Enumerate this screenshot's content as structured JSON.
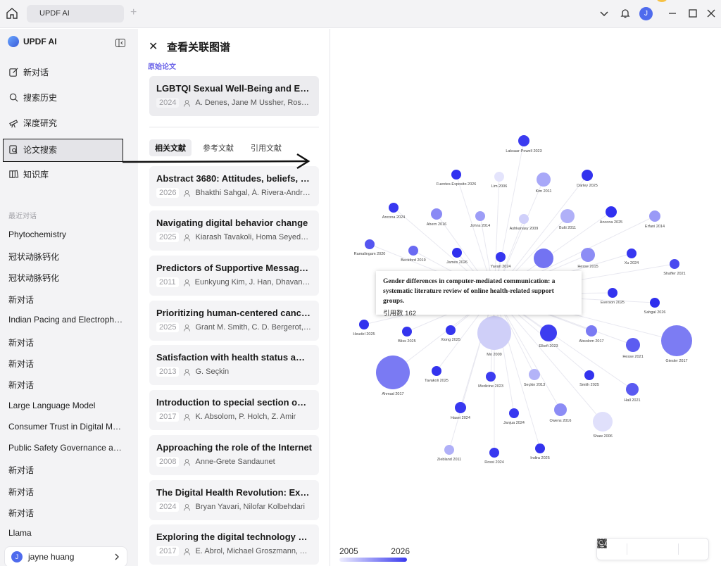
{
  "titlebar": {
    "tab_label": "UPDF AI",
    "avatar_letter": "J"
  },
  "sidebar": {
    "brand": "UPDF AI",
    "nav": [
      {
        "label": "新对话",
        "icon": "edit-icon"
      },
      {
        "label": "搜索历史",
        "icon": "search-icon"
      },
      {
        "label": "深度研究",
        "icon": "telescope-icon"
      },
      {
        "label": "论文搜索",
        "icon": "paper-search-icon"
      },
      {
        "label": "知识库",
        "icon": "book-icon"
      }
    ],
    "recent_label": "最近对话",
    "recent": [
      "Phytochemistry",
      "冠状动脉钙化",
      "冠状动脉钙化",
      "新对话",
      "Indian Pacing and Electrophysiology Jo...",
      "新对话",
      "新对话",
      "新对话",
      "Large Language Model",
      "Consumer Trust in Digital Marketing",
      "Public Safety Governance and ...",
      "新对话",
      "新对话",
      "新对话",
      "Llama"
    ],
    "user": {
      "avatar_letter": "J",
      "name": "jayne huang"
    }
  },
  "panel": {
    "title": "查看关联图谱",
    "orig_label": "原始论文",
    "orig": {
      "title": "LGBTQI Sexual Well-Being and Empowerment",
      "year": "2024",
      "authors": "A. Denes, Jane M Ussher, Rosalie Power"
    },
    "tabs": [
      "相关文献",
      "参考文献",
      "引用文献"
    ],
    "items": [
      {
        "title": "Abstract 3680: Attitudes, beliefs, and practices",
        "year": "2026",
        "authors": "Bhakthi Sahgal, Á. Rivera-Andrade"
      },
      {
        "title": "Navigating digital behavior change",
        "year": "2025",
        "authors": "Kiarash Tavakoli, Homa Seyedmehdi"
      },
      {
        "title": "Predictors of Supportive Message Expression",
        "year": "2011",
        "authors": "Eunkyung Kim, J. Han, Dhavan Shah"
      },
      {
        "title": "Prioritizing human-centered cancer care",
        "year": "2025",
        "authors": "Grant M. Smith, C. D. Bergerot, ..."
      },
      {
        "title": "Satisfaction with health status among",
        "year": "2013",
        "authors": "G. Seçkin"
      },
      {
        "title": "Introduction to special section on online",
        "year": "2017",
        "authors": "K. Absolom, P. Holch, Z. Amir"
      },
      {
        "title": "Approaching the role of the Internet",
        "year": "2008",
        "authors": "Anne-Grete Sandaunet"
      },
      {
        "title": "The Digital Health Revolution: Exploring",
        "year": "2024",
        "authors": "Bryan Yavari, Nilofar Kolbehdari"
      },
      {
        "title": "Exploring the digital technology preferences",
        "year": "2017",
        "authors": "E. Abrol, Michael Groszmann, A. Pitman"
      }
    ]
  },
  "graph": {
    "tooltip": {
      "title": "Gender differences in computer-mediated communication: a systematic literature review of online health-related support groups.",
      "cite": "引用数 162"
    },
    "legend": {
      "min": "2005",
      "max": "2026"
    },
    "center_color": "#dcdcf8",
    "nodes": [
      {
        "label": "Laksaar-Powell 2023",
        "c": "#3b3bf0"
      },
      {
        "label": "Fuentes-Exposito 2026",
        "c": "#3030f0"
      },
      {
        "label": "Lim 2006",
        "c": "#e4e4fc"
      },
      {
        "label": "Kim 2011",
        "c": "#a8a8f8"
      },
      {
        "label": "Darley 2025",
        "c": "#3333ee"
      },
      {
        "label": "Ancona 2024",
        "c": "#3838f0"
      },
      {
        "label": "Ahern 2016",
        "c": "#8a8af5"
      },
      {
        "label": "Johns 2014",
        "c": "#9d9df7"
      },
      {
        "label": "Ashkanasy 2009",
        "c": "#d0d0fa"
      },
      {
        "label": "Bulti 2011",
        "c": "#b0b0f8"
      },
      {
        "label": "Ancona 2025",
        "c": "#3030f0"
      },
      {
        "label": "Erfani 2014",
        "c": "#9a9af7"
      },
      {
        "label": "Ramalingam 2020",
        "c": "#5555f0"
      },
      {
        "label": "Beckford 2019",
        "c": "#6a6af2"
      },
      {
        "label": "James 2026",
        "c": "#2f2fee"
      },
      {
        "label": "Yavari 2024",
        "c": "#3636ef"
      },
      {
        "label": "Hesse 2015",
        "c": "#8d8df5"
      },
      {
        "label": "Xu 2024",
        "c": "#3737f0"
      },
      {
        "label": "Shaffer 2021",
        "c": "#4a4af0"
      },
      {
        "label": "Everson 2025",
        "c": "#3333ee"
      },
      {
        "label": "Sahgal 2026",
        "c": "#2f2fee"
      },
      {
        "label": "Heudel 2025",
        "c": "#3232ee"
      },
      {
        "label": "Bliss 2025",
        "c": "#3434ee"
      },
      {
        "label": "Xiong 2025",
        "c": "#3434ee"
      },
      {
        "label": "Mo 2009",
        "c": "#cfcff8"
      },
      {
        "label": "Elkefi 2023",
        "c": "#3d3df0"
      },
      {
        "label": "Absolom 2017",
        "c": "#7a7af3"
      },
      {
        "label": "Hesse 2021",
        "c": "#5c5cf1"
      },
      {
        "label": "Giesler 2017",
        "c": "#7c7cf3"
      },
      {
        "label": "Tavakoli 2025",
        "c": "#3333ee"
      },
      {
        "label": "Medicine 2023",
        "c": "#3c3cf0"
      },
      {
        "label": "Seçkin 2013",
        "c": "#b3b3f8"
      },
      {
        "label": "Smith 2025",
        "c": "#3333ee"
      },
      {
        "label": "Ahmad 2017",
        "c": "#7a7af3"
      },
      {
        "label": "Hall 2021",
        "c": "#5a5af1"
      },
      {
        "label": "Hasei 2024",
        "c": "#3838f0"
      },
      {
        "label": "Janjua 2024",
        "c": "#3838f0"
      },
      {
        "label": "Owens 2016",
        "c": "#8c8cf5"
      },
      {
        "label": "Shaw 2006",
        "c": "#e0e0fb"
      },
      {
        "label": "Ziebland 2011",
        "c": "#b0b0f8"
      },
      {
        "label": "Rossi 2024",
        "c": "#3838f0"
      },
      {
        "label": "Indira 2025",
        "c": "#3333ee"
      }
    ]
  }
}
